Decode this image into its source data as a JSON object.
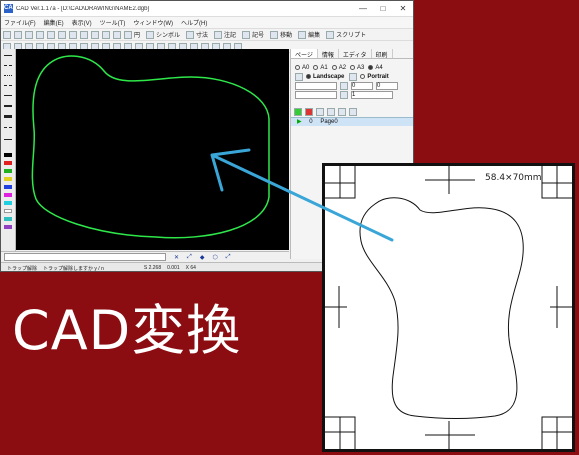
{
  "app": {
    "title": "CAD Ver.1.17a - [D:\\CAD\\DRAWING\\NAME2.dgb]",
    "icon_label": "CAD",
    "window_buttons": [
      "—",
      "□",
      "✕"
    ]
  },
  "menu": {
    "items": [
      "ファイル(F)",
      "編集(E)",
      "表示(V)",
      "ツール(T)",
      "ウィンドウ(W)",
      "ヘルプ(H)"
    ]
  },
  "toolbar": {
    "groups": [
      "円",
      "シンボル",
      "寸法",
      "注記",
      "記号",
      "移動",
      "編集",
      "スクリプト"
    ]
  },
  "right_panel": {
    "tabs": [
      "ページ",
      "情報",
      "エディタ",
      "印刷"
    ],
    "paper_sizes": [
      "A0",
      "A1",
      "A2",
      "A3",
      "A4"
    ],
    "selected_paper": "A4",
    "orientation_landscape": "Landscape",
    "orientation_portrait": "Portrait",
    "field_values": [
      "0",
      "0",
      "1"
    ],
    "page_row_label": "0",
    "page_name": "Page0"
  },
  "command_bar": {
    "icons": [
      "✕",
      "⤢",
      "◆",
      "⬡",
      "⤢"
    ]
  },
  "status_bar": {
    "left_text": "トラップ解除",
    "mid_text": "トラップ解除しますか y / n",
    "scale": "S 2.268",
    "coord": "0.001",
    "x_readout": "X 64"
  },
  "colors": {
    "background": "#8b0d12",
    "canvas": "#000000",
    "shape_stroke": "#2ee84a",
    "arrow": "#3aa6d8"
  },
  "overlay": {
    "big_label": "CAD変換",
    "paper_dimension": "58.4×70mm"
  }
}
